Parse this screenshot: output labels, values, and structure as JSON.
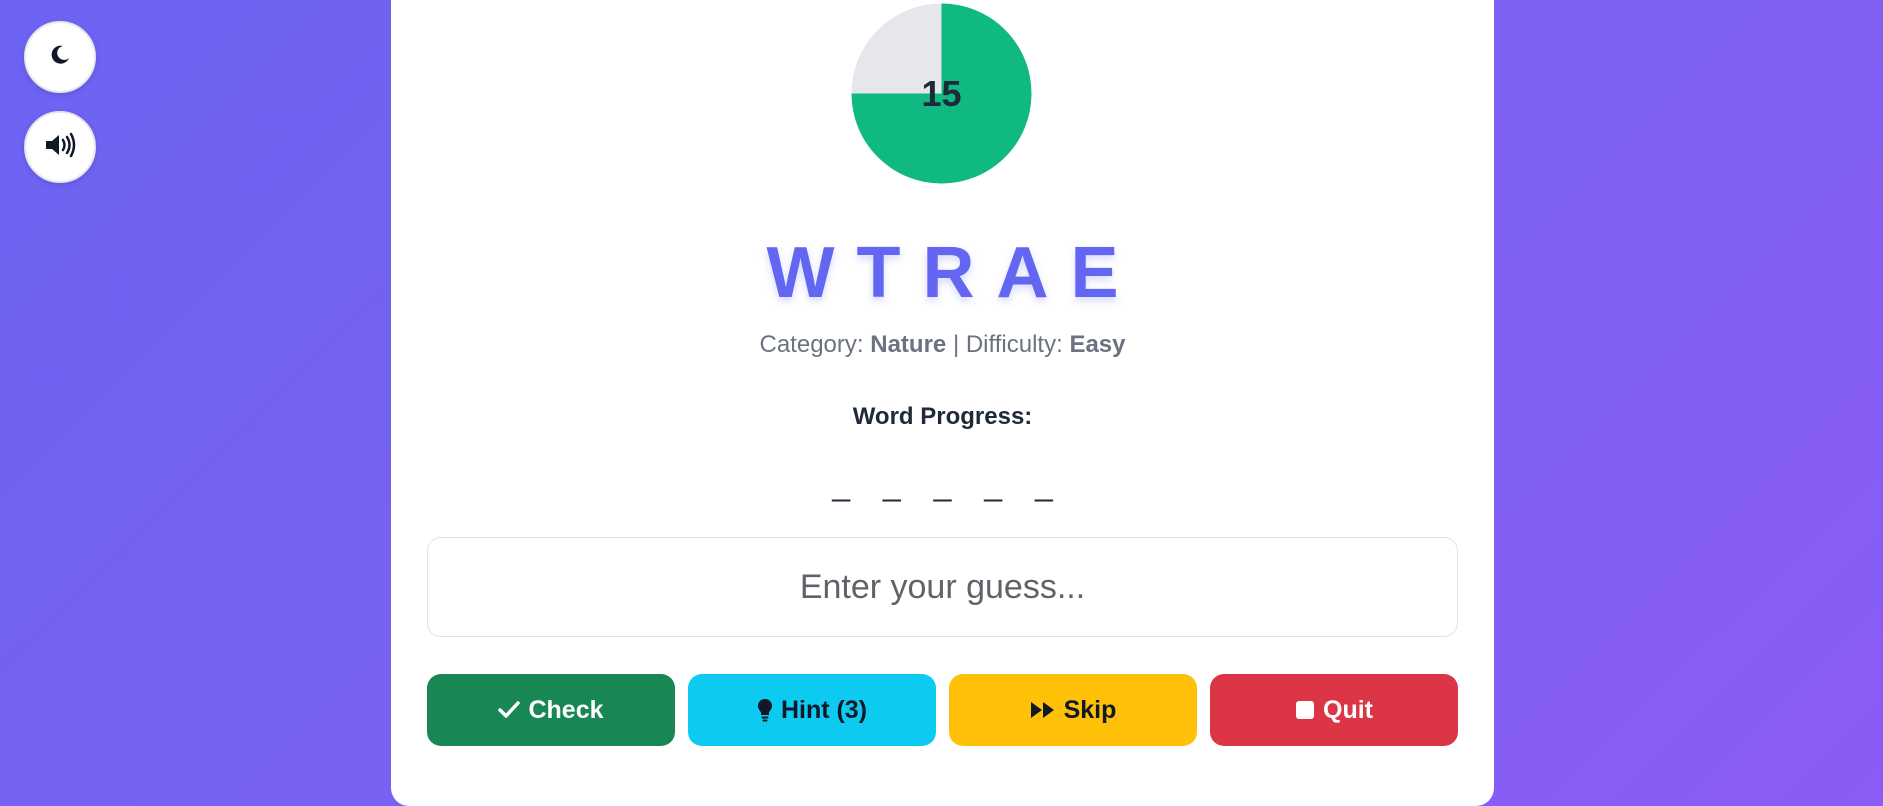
{
  "controls": {
    "theme_icon": "moon-icon",
    "sound_icon": "volume-icon"
  },
  "timer": {
    "value": "15",
    "remaining_fraction": 0.75,
    "fill_color": "#10b981",
    "track_color": "#e5e7eb"
  },
  "game": {
    "scrambled_word": "WTRAE",
    "category_label": "Category:",
    "category_value": "Nature",
    "separator": "|",
    "difficulty_label": "Difficulty:",
    "difficulty_value": "Easy",
    "progress_label": "Word Progress:",
    "progress_blanks": "_ _ _ _ _"
  },
  "guess_input": {
    "placeholder": "Enter your guess...",
    "value": ""
  },
  "buttons": {
    "check_label": "Check",
    "hint_label": "Hint (3)",
    "skip_label": "Skip",
    "quit_label": "Quit"
  },
  "colors": {
    "accent": "#6366f1",
    "check": "#198754",
    "hint": "#0dcaf0",
    "skip": "#ffc107",
    "quit": "#dc3545"
  }
}
